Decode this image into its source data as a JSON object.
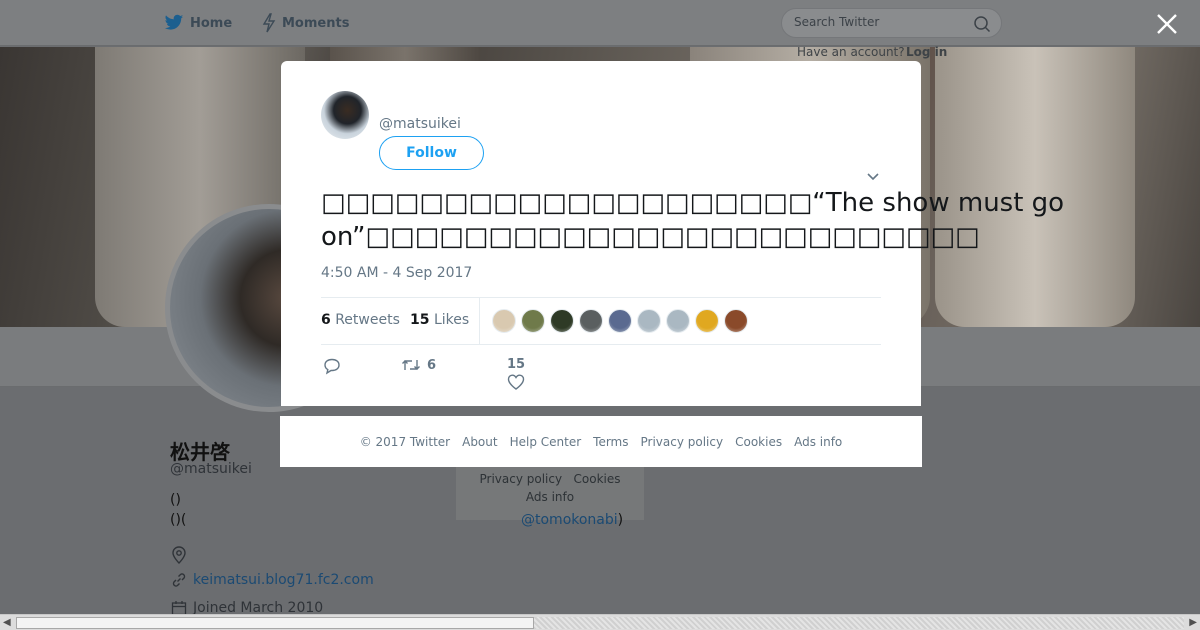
{
  "nav": {
    "home_label": "Home",
    "moments_label": "Moments",
    "search_placeholder": "Search Twitter",
    "have_account_text": "Have an account?",
    "login_label": "Log in"
  },
  "profile": {
    "name": "松井啓",
    "handle": "@matsuikei",
    "bio_line1": "()",
    "bio_line2": "()(",
    "url": "keimatsui.blog71.fc2.com",
    "joined": "Joined March 2010",
    "mention": "@tomokonabi",
    "mention_suffix": ")"
  },
  "side_footer": {
    "privacy": "Privacy policy",
    "cookies": "Cookies",
    "ads": "Ads info"
  },
  "tweet": {
    "handle": "@matsuikei",
    "follow_label": "Follow",
    "text": "□□□□□□□□□□□□□□□□□□□□“The show must go on”□□□□□□□□□□□□□□□□□□□□□□□□□",
    "timestamp": "4:50 AM - 4 Sep 2017",
    "retweet_count": "6",
    "retweet_label": "Retweets",
    "like_count": "15",
    "like_label": "Likes",
    "action_retweet_count": "6",
    "action_like_count": "15",
    "liker_colors": [
      "#d9c9b0",
      "#6f7a4a",
      "#2e3a26",
      "#5a5f60",
      "#5a6a90",
      "#aab8c2",
      "#aab8c2",
      "#e0a820",
      "#8a4a2a"
    ]
  },
  "footer": {
    "copyright": "© 2017 Twitter",
    "about": "About",
    "help": "Help Center",
    "terms": "Terms",
    "privacy": "Privacy policy",
    "cookies": "Cookies",
    "ads": "Ads info"
  },
  "colors": {
    "accent": "#1da1f2",
    "muted": "#657786"
  }
}
